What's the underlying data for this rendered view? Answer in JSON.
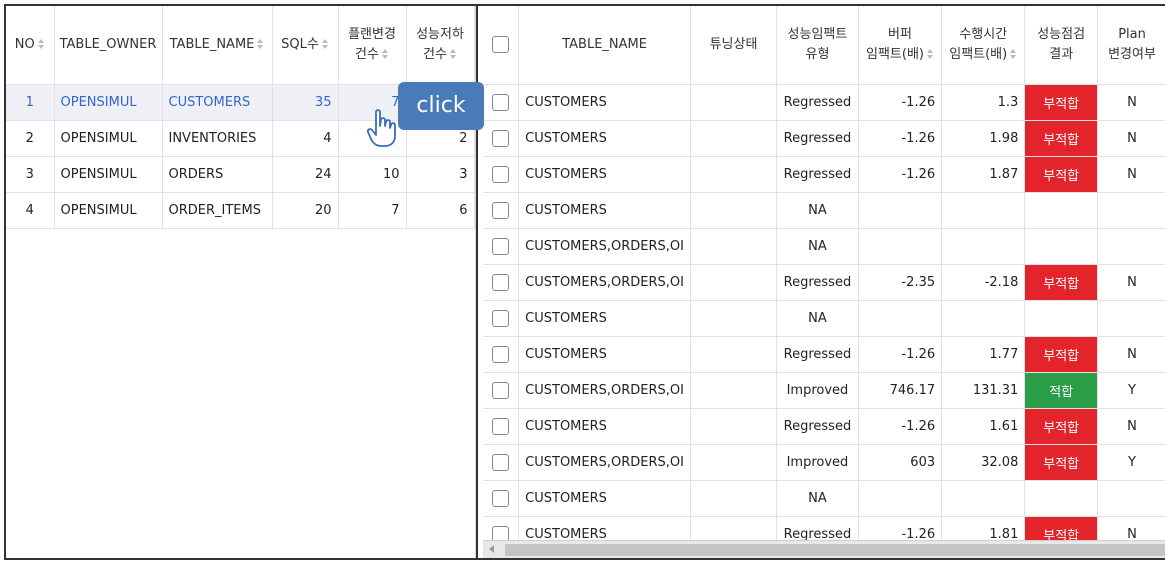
{
  "left_table": {
    "headers": {
      "no": "NO",
      "owner": "TABLE_OWNER",
      "name": "TABLE_NAME",
      "sql": "SQL수",
      "plan_line1": "플랜변경",
      "plan_line2": "건수",
      "perf_line1": "성능저하",
      "perf_line2": "건수"
    },
    "rows": [
      {
        "no": "1",
        "owner": "OPENSIMUL",
        "name": "CUSTOMERS",
        "sql": "35",
        "plan": "7",
        "perf": "",
        "selected": true
      },
      {
        "no": "2",
        "owner": "OPENSIMUL",
        "name": "INVENTORIES",
        "sql": "4",
        "plan": "",
        "perf": "2"
      },
      {
        "no": "3",
        "owner": "OPENSIMUL",
        "name": "ORDERS",
        "sql": "24",
        "plan": "10",
        "perf": "3"
      },
      {
        "no": "4",
        "owner": "OPENSIMUL",
        "name": "ORDER_ITEMS",
        "sql": "20",
        "plan": "7",
        "perf": "6"
      }
    ]
  },
  "right_table": {
    "headers": {
      "table_name": "TABLE_NAME",
      "tuning": "튜닝상태",
      "impact_type_l1": "성능임팩트",
      "impact_type_l2": "유형",
      "buffer_l1": "버퍼",
      "buffer_l2": "임팩트(배)",
      "elapsed_l1": "수행시간",
      "elapsed_l2": "임팩트(배)",
      "result_l1": "성능점검",
      "result_l2": "결과",
      "plan_l1": "Plan",
      "plan_l2": "변경여부"
    },
    "rows": [
      {
        "name": "CUSTOMERS",
        "tuning": "",
        "type": "Regressed",
        "buffer": "-1.26",
        "elapsed": "1.3",
        "result": "부적합",
        "status": "bad",
        "plan": "N"
      },
      {
        "name": "CUSTOMERS",
        "tuning": "",
        "type": "Regressed",
        "buffer": "-1.26",
        "elapsed": "1.98",
        "result": "부적합",
        "status": "bad",
        "plan": "N"
      },
      {
        "name": "CUSTOMERS",
        "tuning": "",
        "type": "Regressed",
        "buffer": "-1.26",
        "elapsed": "1.87",
        "result": "부적합",
        "status": "bad",
        "plan": "N"
      },
      {
        "name": "CUSTOMERS",
        "tuning": "",
        "type": "NA",
        "buffer": "",
        "elapsed": "",
        "result": "",
        "status": "",
        "plan": ""
      },
      {
        "name": "CUSTOMERS,ORDERS,OI",
        "tuning": "",
        "type": "NA",
        "buffer": "",
        "elapsed": "",
        "result": "",
        "status": "",
        "plan": ""
      },
      {
        "name": "CUSTOMERS,ORDERS,OI",
        "tuning": "",
        "type": "Regressed",
        "buffer": "-2.35",
        "elapsed": "-2.18",
        "result": "부적합",
        "status": "bad",
        "plan": "N"
      },
      {
        "name": "CUSTOMERS",
        "tuning": "",
        "type": "NA",
        "buffer": "",
        "elapsed": "",
        "result": "",
        "status": "",
        "plan": ""
      },
      {
        "name": "CUSTOMERS",
        "tuning": "",
        "type": "Regressed",
        "buffer": "-1.26",
        "elapsed": "1.77",
        "result": "부적합",
        "status": "bad",
        "plan": "N"
      },
      {
        "name": "CUSTOMERS,ORDERS,OI",
        "tuning": "",
        "type": "Improved",
        "buffer": "746.17",
        "elapsed": "131.31",
        "result": "적합",
        "status": "good",
        "plan": "Y"
      },
      {
        "name": "CUSTOMERS",
        "tuning": "",
        "type": "Regressed",
        "buffer": "-1.26",
        "elapsed": "1.61",
        "result": "부적합",
        "status": "bad",
        "plan": "N"
      },
      {
        "name": "CUSTOMERS,ORDERS,OI",
        "tuning": "",
        "type": "Improved",
        "buffer": "603",
        "elapsed": "32.08",
        "result": "부적합",
        "status": "bad",
        "plan": "Y"
      },
      {
        "name": "CUSTOMERS",
        "tuning": "",
        "type": "NA",
        "buffer": "",
        "elapsed": "",
        "result": "",
        "status": "",
        "plan": ""
      },
      {
        "name": "CUSTOMERS",
        "tuning": "",
        "type": "Regressed",
        "buffer": "-1.26",
        "elapsed": "1.81",
        "result": "부적합",
        "status": "bad",
        "plan": "N"
      }
    ]
  },
  "tooltip": {
    "text": "click"
  },
  "colors": {
    "bad": "#e3242b",
    "good": "#2b9d48",
    "link": "#3366cc",
    "tooltip": "#4a7ab8"
  },
  "icons": {
    "cursor": "hand-pointer-icon",
    "sort": "sort-arrows-icon",
    "checkbox": "checkbox-icon"
  }
}
